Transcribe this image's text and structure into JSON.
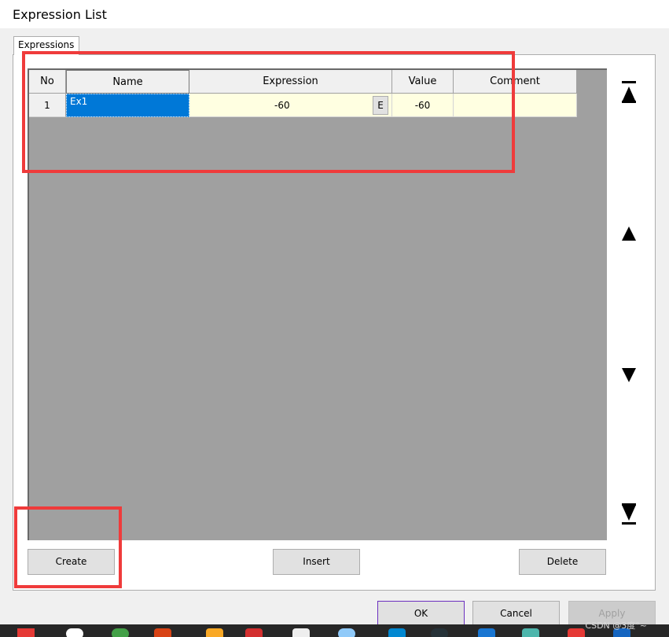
{
  "window": {
    "title": "Expression List"
  },
  "tab": {
    "label": "Expressions"
  },
  "table": {
    "headers": [
      "No",
      "Name",
      "Expression",
      "Value",
      "Comment"
    ],
    "rows": [
      {
        "no": "1",
        "name": "Ex1",
        "expression": "-60",
        "expr_button": "E",
        "value": "-60",
        "comment": ""
      }
    ]
  },
  "nav": {
    "move_top": "move-first-icon",
    "move_up": "move-up-icon",
    "move_down": "move-down-icon",
    "move_bottom": "move-last-icon"
  },
  "actions": {
    "create": "Create",
    "insert": "Insert",
    "delete": "Delete"
  },
  "dialog_buttons": {
    "ok": "OK",
    "cancel": "Cancel",
    "apply": "Apply"
  },
  "watermark": "CSDN @3度°~",
  "colors": {
    "selection": "#0078d7",
    "cell_bg": "#ffffe1",
    "grid_bg": "#a0a0a0",
    "annotation": "#ef3b3b"
  }
}
